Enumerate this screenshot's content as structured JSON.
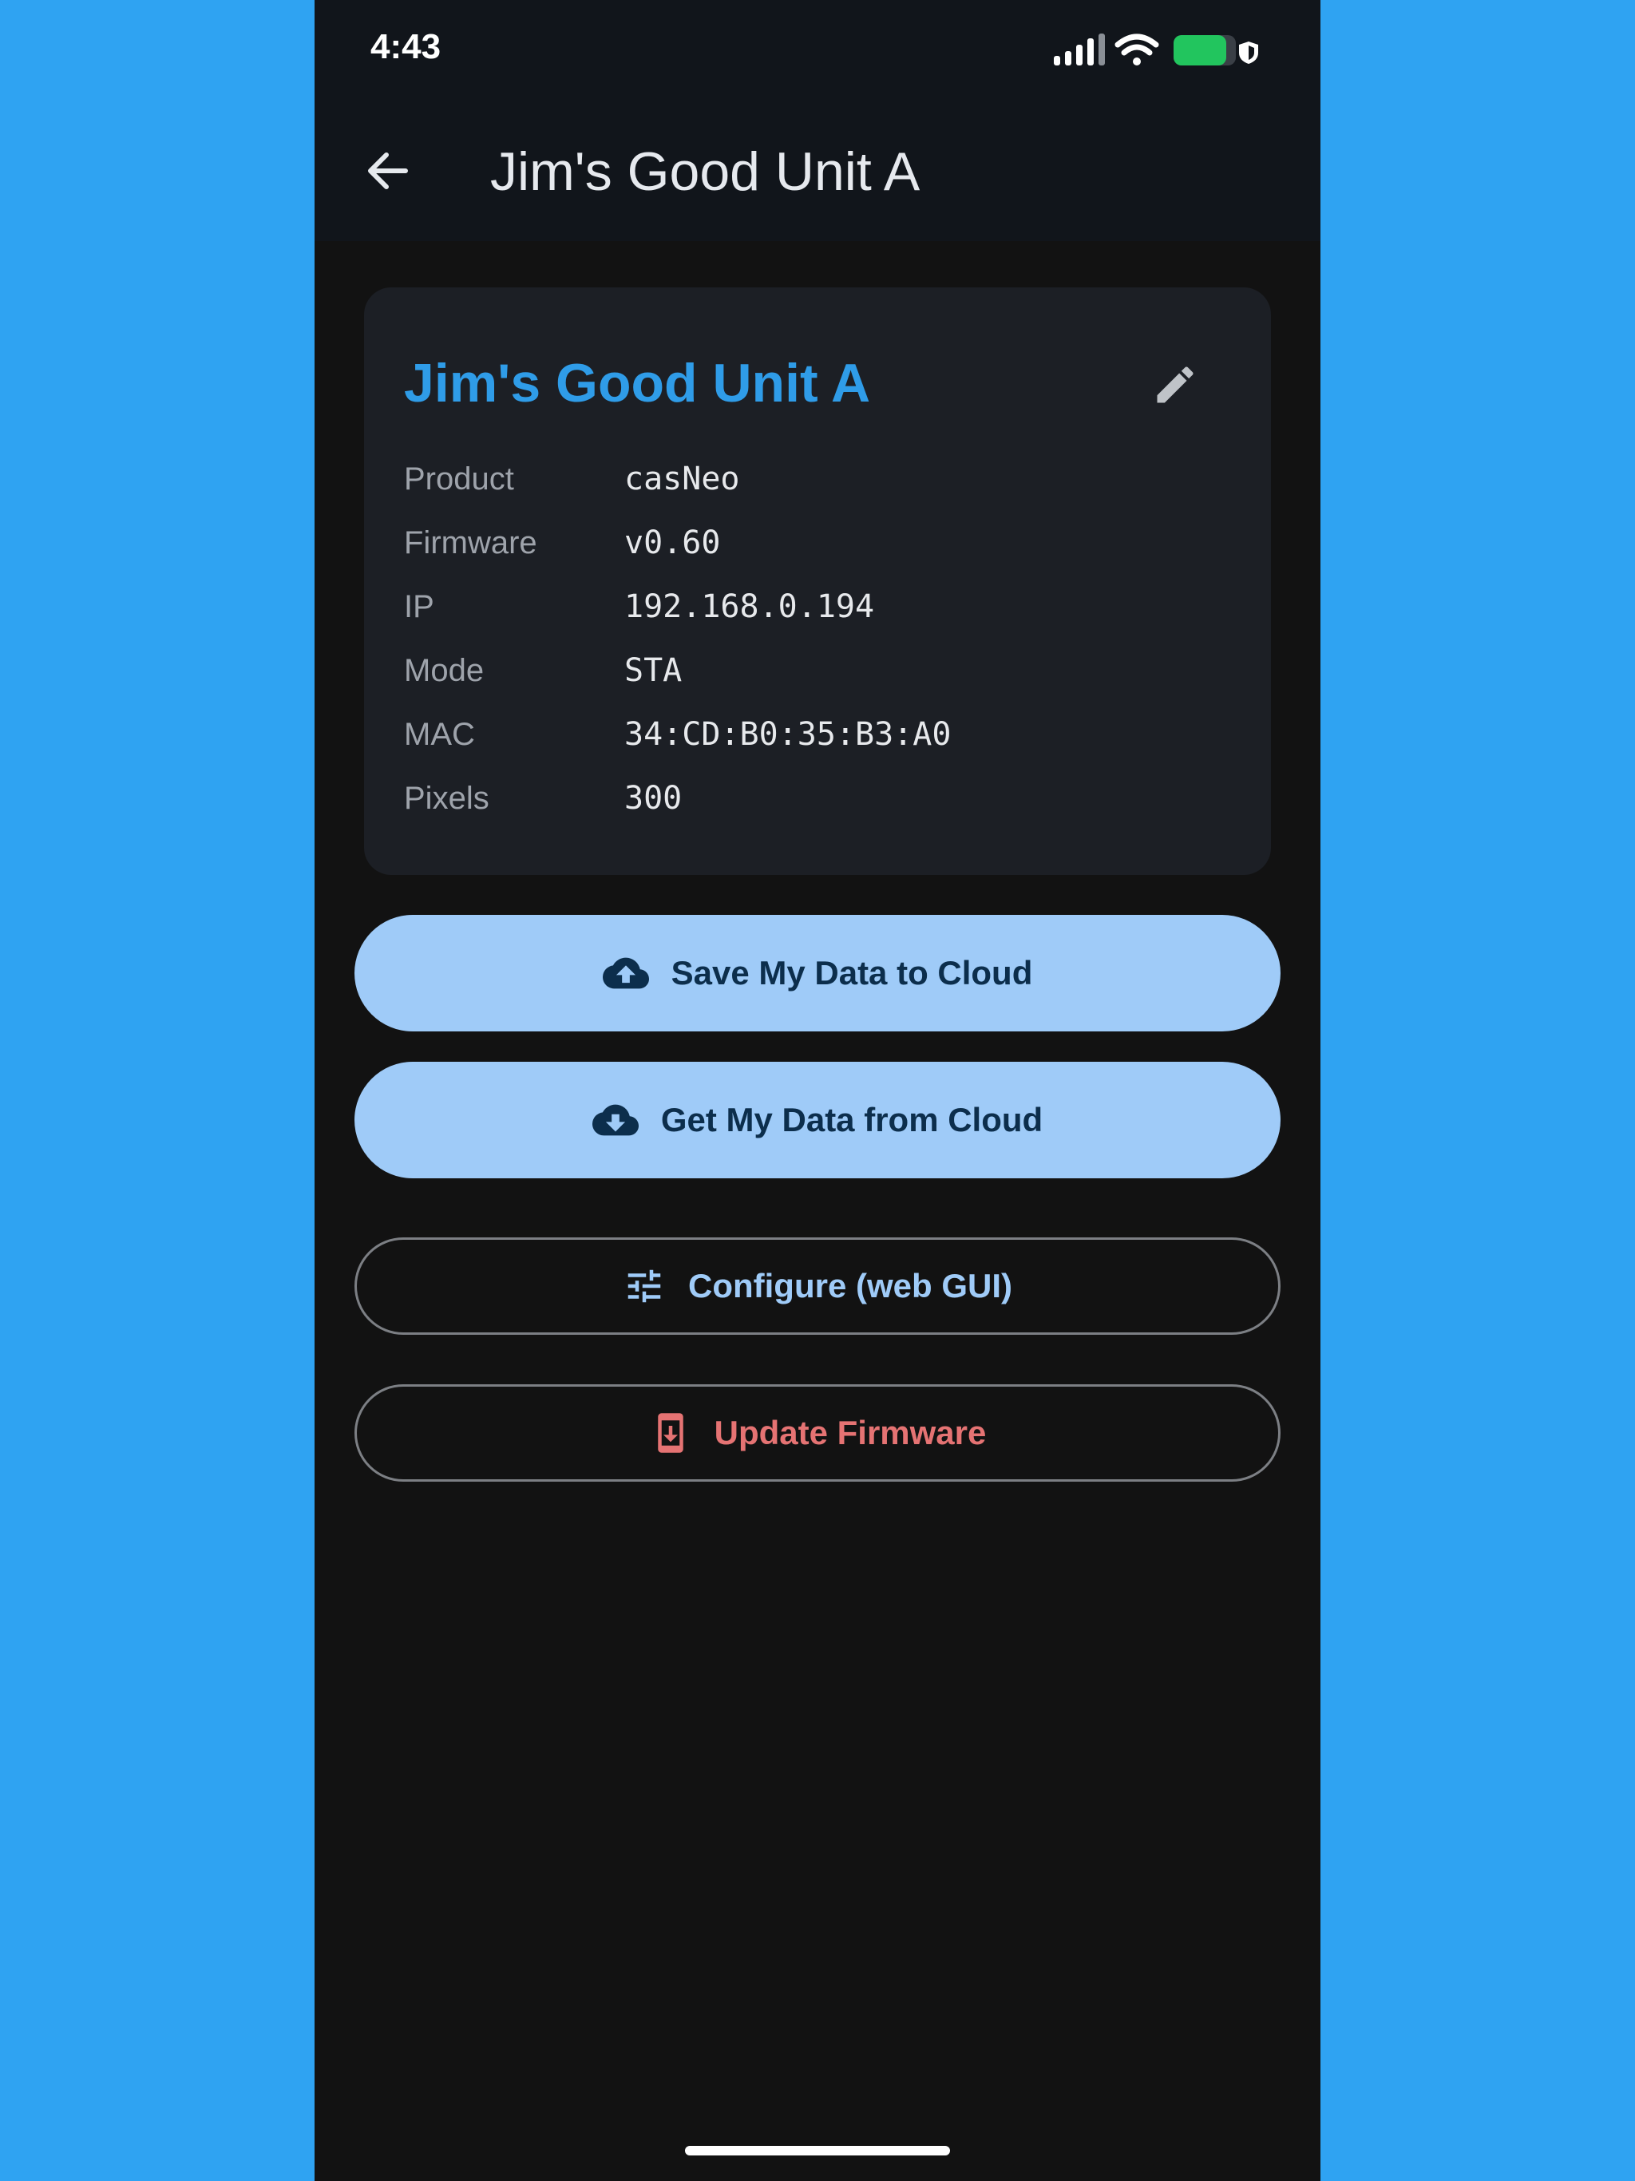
{
  "status_bar": {
    "time": "4:43",
    "signal_icon": "cellular-signal-icon",
    "wifi_icon": "wifi-icon",
    "battery_icon": "battery-icon",
    "battery_color": "#22c55e"
  },
  "app_bar": {
    "back_icon": "arrow-back-icon",
    "title": "Jim's Good Unit A"
  },
  "device_card": {
    "name": "Jim's Good Unit A",
    "name_color": "#2f9ce8",
    "edit_icon": "pencil-icon",
    "rows": [
      {
        "label": "Product",
        "value": "casNeo"
      },
      {
        "label": "Firmware",
        "value": "v0.60"
      },
      {
        "label": "IP",
        "value": "192.168.0.194"
      },
      {
        "label": "Mode",
        "value": "STA"
      },
      {
        "label": "MAC",
        "value": "34:CD:B0:35:B3:A0"
      },
      {
        "label": "Pixels",
        "value": "300"
      }
    ]
  },
  "actions": {
    "save_label": "Save My Data to Cloud",
    "save_icon": "cloud-upload-icon",
    "get_label": "Get My Data from Cloud",
    "get_icon": "cloud-download-icon",
    "configure_label": "Configure (web GUI)",
    "configure_icon": "tune-icon",
    "update_label": "Update Firmware",
    "update_icon": "system-update-icon",
    "primary_color": "#9fcbf8",
    "danger_color": "#e57373"
  }
}
